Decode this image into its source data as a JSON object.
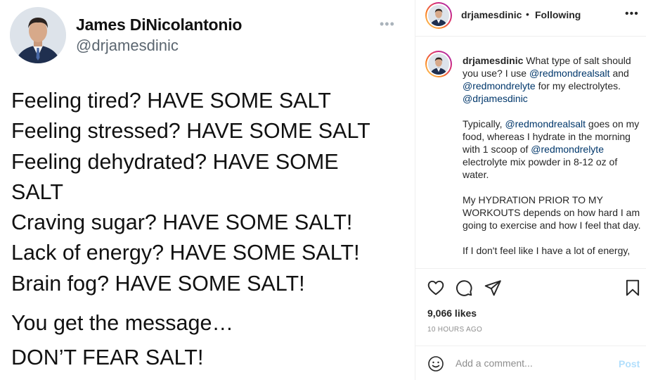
{
  "tweet": {
    "author_name": "James DiNicolantonio",
    "author_handle": "@drjamesdinic",
    "more": "•••",
    "lines": [
      "Feeling tired? HAVE SOME SALT",
      "Feeling stressed? HAVE SOME SALT",
      "Feeling dehydrated? HAVE SOME",
      "SALT",
      "Craving sugar? HAVE SOME SALT!",
      "Lack of energy?  HAVE SOME SALT!",
      "Brain fog? HAVE SOME SALT!"
    ],
    "message": "You get the message…",
    "closing": "DON’T FEAR SALT!"
  },
  "header": {
    "username": "drjamesdinic",
    "separator": "•",
    "follow_status": "Following",
    "more": "•••"
  },
  "caption": {
    "username": "drjamesdinic",
    "p1": {
      "a": " What type of salt should you use? I use ",
      "m1": "@redmondrealsalt",
      "b": " and ",
      "m2": "@redmondrelyte",
      "c": " for my electrolytes. ",
      "m3": "@drjamesdinic"
    },
    "p2": {
      "a": "Typically, ",
      "m1": "@redmondrealsalt",
      "b": " goes on my food, whereas I hydrate in the morning with 1 scoop of ",
      "m2": "@redmondrelyte",
      "c": " electrolyte mix powder in 8-12 oz of water."
    },
    "p3": "My HYDRATION PRIOR TO MY WORKOUTS depends on how hard I am going to exercise and how I feel that day.",
    "p4": "If I don't feel like I have a lot of energy,"
  },
  "actions": {
    "icons": [
      "heart-icon",
      "comment-icon",
      "share-icon",
      "bookmark-icon"
    ],
    "likes": "9,066 likes",
    "timestamp": "10 HOURS AGO"
  },
  "comment": {
    "placeholder": "Add a comment...",
    "post_label": "Post"
  },
  "colors": {
    "mention": "#00376b",
    "post_disabled": "#b2dffc",
    "secondary_text": "#8e8e8e"
  }
}
